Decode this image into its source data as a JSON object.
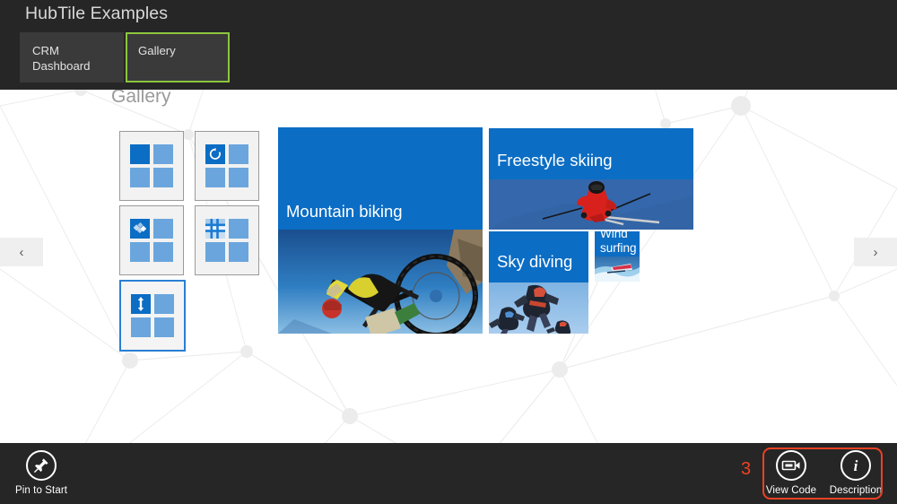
{
  "header": {
    "app_title": "HubTile Examples",
    "tabs": [
      {
        "label": "CRM\nDashboard",
        "selected": false
      },
      {
        "label": "Gallery",
        "selected": true
      }
    ],
    "selected_tab_outline_color": "#8cc63e"
  },
  "page": {
    "heading": "Gallery",
    "background_color": "#ffffff"
  },
  "nav": {
    "prev_label": "‹",
    "next_label": "›"
  },
  "thumbnails": [
    {
      "name": "static-tile",
      "icon": "none",
      "selected": false
    },
    {
      "name": "rotate-tile",
      "icon": "rotate-icon",
      "selected": false
    },
    {
      "name": "shuffle-tile",
      "icon": "shuffle-icon",
      "selected": false
    },
    {
      "name": "grid-tile",
      "icon": "grid-icon",
      "selected": false
    },
    {
      "name": "slide-tile",
      "icon": "slide-vertical-icon",
      "selected": true
    }
  ],
  "tiles": [
    {
      "title": "Mountain biking",
      "photo": "mountain-biking-photo",
      "size": "large"
    },
    {
      "title": "Freestyle skiing",
      "photo": "freestyle-skiing-photo",
      "size": "wide"
    },
    {
      "title": "Sky diving",
      "photo": "sky-diving-photo",
      "size": "medium"
    },
    {
      "title": "Wind\nsurfing",
      "photo": "wind-surfing-photo",
      "size": "small"
    }
  ],
  "appbar": {
    "pin_label": "Pin to Start",
    "view_code_label": "View Code",
    "description_label": "Description"
  },
  "annotation": {
    "number": "3",
    "color": "#ef4123"
  },
  "colors": {
    "tile_blue": "#0b6dc4",
    "chrome_dark": "#262626",
    "accent_green": "#8cc63e",
    "select_blue": "#2a7fd4"
  }
}
